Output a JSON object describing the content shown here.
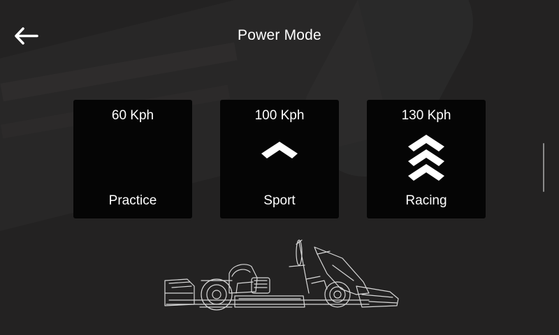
{
  "header": {
    "title": "Power Mode",
    "back_icon": "arrow-left-icon"
  },
  "modes": [
    {
      "speed": "60 Kph",
      "label": "Practice",
      "icon": "none"
    },
    {
      "speed": "100 Kph",
      "label": "Sport",
      "icon": "single-chevron-up-icon"
    },
    {
      "speed": "130 Kph",
      "label": "Racing",
      "icon": "triple-chevron-up-icon"
    }
  ],
  "illustration": "go-kart-icon",
  "colors": {
    "background": "#232222",
    "card": "#050505",
    "text": "#ffffff"
  }
}
